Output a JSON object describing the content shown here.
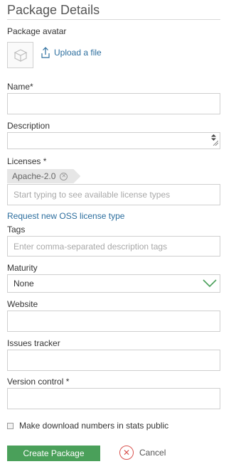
{
  "page": {
    "title": "Package Details"
  },
  "avatar": {
    "label": "Package avatar",
    "upload_label": "Upload a file"
  },
  "name": {
    "label": "Name*",
    "value": ""
  },
  "description": {
    "label": "Description",
    "value": ""
  },
  "licenses": {
    "label": "Licenses *",
    "tags": [
      "Apache-2.0"
    ],
    "placeholder": "Start typing to see available license types",
    "request_link": "Request new OSS license type"
  },
  "tags": {
    "label": "Tags",
    "placeholder": "Enter comma-separated description tags"
  },
  "maturity": {
    "label": "Maturity",
    "selected": "None"
  },
  "website": {
    "label": "Website",
    "value": ""
  },
  "issues_tracker": {
    "label": "Issues tracker",
    "value": ""
  },
  "version_control": {
    "label": "Version control *",
    "value": ""
  },
  "stats_checkbox": {
    "label": "Make download numbers in stats public",
    "checked": false
  },
  "actions": {
    "create_label": "Create Package",
    "cancel_label": "Cancel"
  },
  "colors": {
    "primary": "#4aa05a",
    "link": "#2c6e9e",
    "cancel": "#d9534f"
  }
}
